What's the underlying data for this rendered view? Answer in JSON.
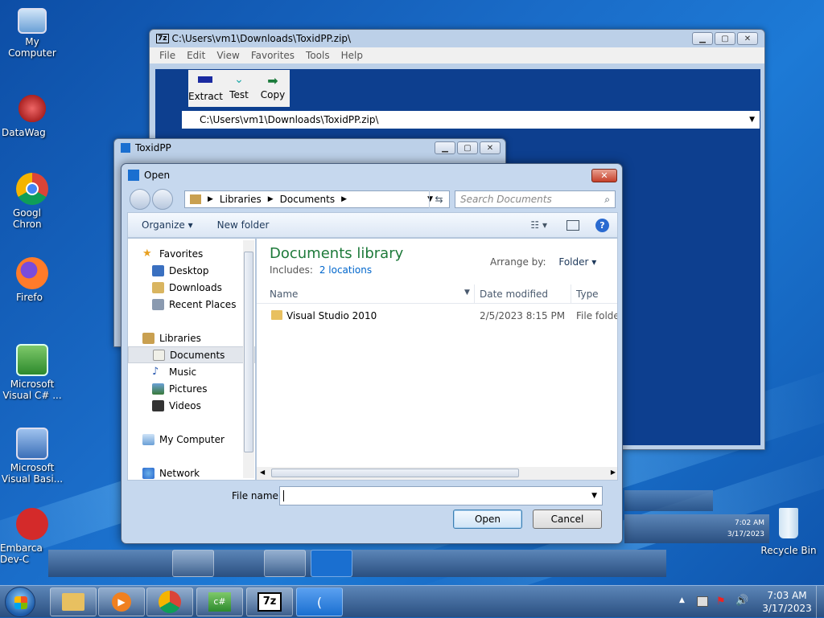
{
  "desktop": {
    "icons": [
      {
        "label": "My Computer"
      },
      {
        "label": "DataWag"
      },
      {
        "label": "Googl Chron"
      },
      {
        "label": "Firefo"
      },
      {
        "label": "Microsoft Visual C# ..."
      },
      {
        "label": "Microsoft Visual Basi..."
      },
      {
        "label": "Embarca Dev-C"
      },
      {
        "label": "Recycle Bin"
      }
    ]
  },
  "sevenzip": {
    "title": "C:\\Users\\vm1\\Downloads\\ToxidPP.zip\\",
    "menu": [
      "File",
      "Edit",
      "View",
      "Favorites",
      "Tools",
      "Help"
    ],
    "toolbar": [
      "Extract",
      "Test",
      "Copy"
    ],
    "path": "C:\\Users\\vm1\\Downloads\\ToxidPP.zip\\",
    "app_icon": "7z"
  },
  "toxid": {
    "title": "ToxidPP"
  },
  "dialog": {
    "title": "Open",
    "breadcrumb": [
      "Libraries",
      "Documents"
    ],
    "search_placeholder": "Search Documents",
    "organize": "Organize",
    "new_folder": "New folder",
    "nav": {
      "favorites": "Favorites",
      "fav_items": [
        "Desktop",
        "Downloads",
        "Recent Places"
      ],
      "libraries": "Libraries",
      "lib_items": [
        "Documents",
        "Music",
        "Pictures",
        "Videos"
      ],
      "my_computer": "My Computer",
      "network": "Network"
    },
    "library_title": "Documents library",
    "includes_label": "Includes:",
    "includes_link": "2 locations",
    "arrange_label": "Arrange by:",
    "arrange_value": "Folder",
    "columns": [
      "Name",
      "Date modified",
      "Type"
    ],
    "rows": [
      {
        "name": "Visual Studio 2010",
        "date": "2/5/2023 8:15 PM",
        "type": "File folder"
      }
    ],
    "filename_label": "File name:",
    "filename_value": "",
    "open_button": "Open",
    "cancel_button": "Cancel"
  },
  "taskbar": {
    "time": "7:03 AM",
    "date": "3/17/2023",
    "ghost_time": "7:02 AM",
    "ghost_date": "3/17/2023",
    "sevenzip_label": "7z",
    "csharp_label": "c#"
  },
  "colors": {
    "accent": "#1e395b",
    "library_title": "#1e7a3a",
    "link": "#0066cc"
  }
}
